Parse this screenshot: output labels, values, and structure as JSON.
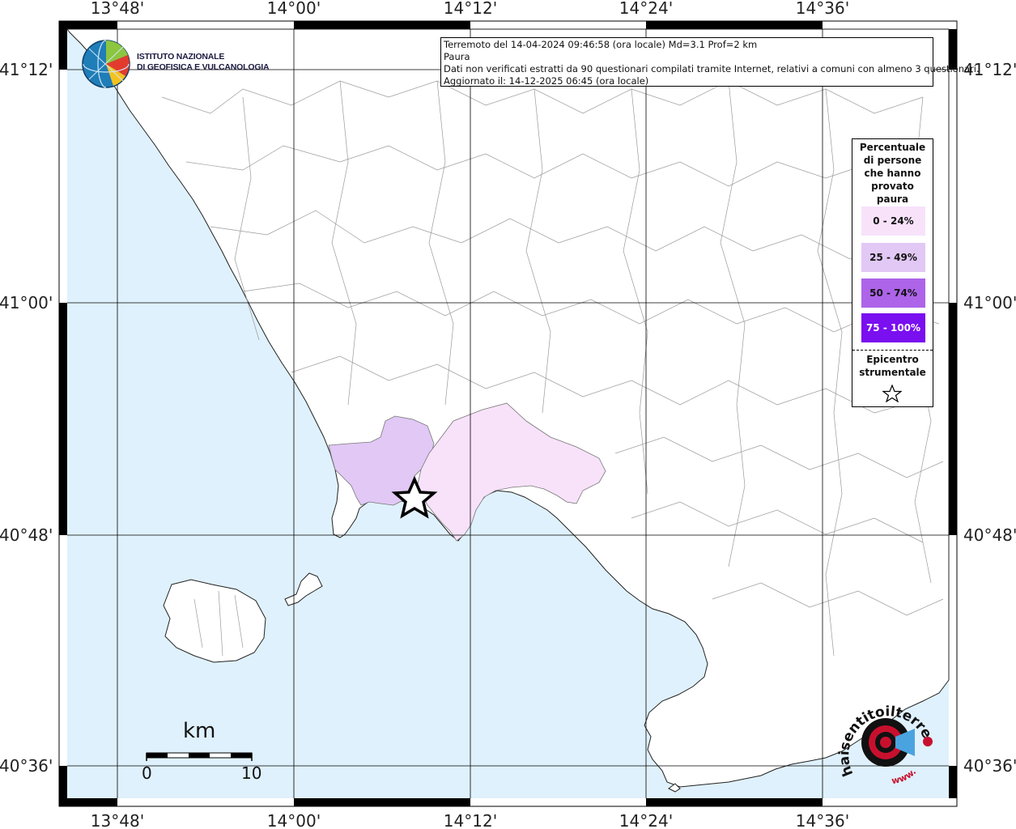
{
  "map": {
    "axes": {
      "longitude_ticks": [
        "13°48'",
        "14°00'",
        "14°12'",
        "14°24'",
        "14°36'"
      ],
      "latitude_ticks": [
        "41°12'",
        "41°00'",
        "40°48'",
        "40°36'"
      ]
    },
    "info": {
      "line1": "Terremoto del 14-04-2024 09:46:58 (ora locale) Md=3.1 Prof=2 km",
      "line2": "Paura",
      "line3": "Dati non verificati estratti da 90 questionari compilati tramite Internet, relativi a comuni con almeno 3 questionari.",
      "line4": "Aggiornato il: 14-12-2025 06:45 (ora locale)"
    },
    "legend": {
      "title": "Percentuale\ndi persone\nche hanno\nprovato\npaura",
      "classes": [
        {
          "label": "0 - 24%",
          "color": "#f7e2fa",
          "text_color": "#111111"
        },
        {
          "label": "25 - 49%",
          "color": "#e1c8f5",
          "text_color": "#111111"
        },
        {
          "label": "50 - 74%",
          "color": "#ad64e8",
          "text_color": "#111111"
        },
        {
          "label": "75 - 100%",
          "color": "#7a0fef",
          "text_color": "#ffffff"
        }
      ],
      "epicenter_label": "Epicentro\nstrumentale"
    },
    "logo": {
      "line1": "ISTITUTO NAZIONALE",
      "line2": "DI GEOFISICA E VULCANOLOGIA"
    },
    "scale": {
      "unit": "km",
      "min_label": "0",
      "max_label": "10"
    },
    "watermark": {
      "text": "haisentitoilterremoto.it",
      "prefix": "www."
    },
    "colors": {
      "sea": "#dff1fc",
      "land": "#ffffff",
      "class_0_24": "#f7e2fa",
      "class_25_49": "#e1c8f5"
    }
  }
}
